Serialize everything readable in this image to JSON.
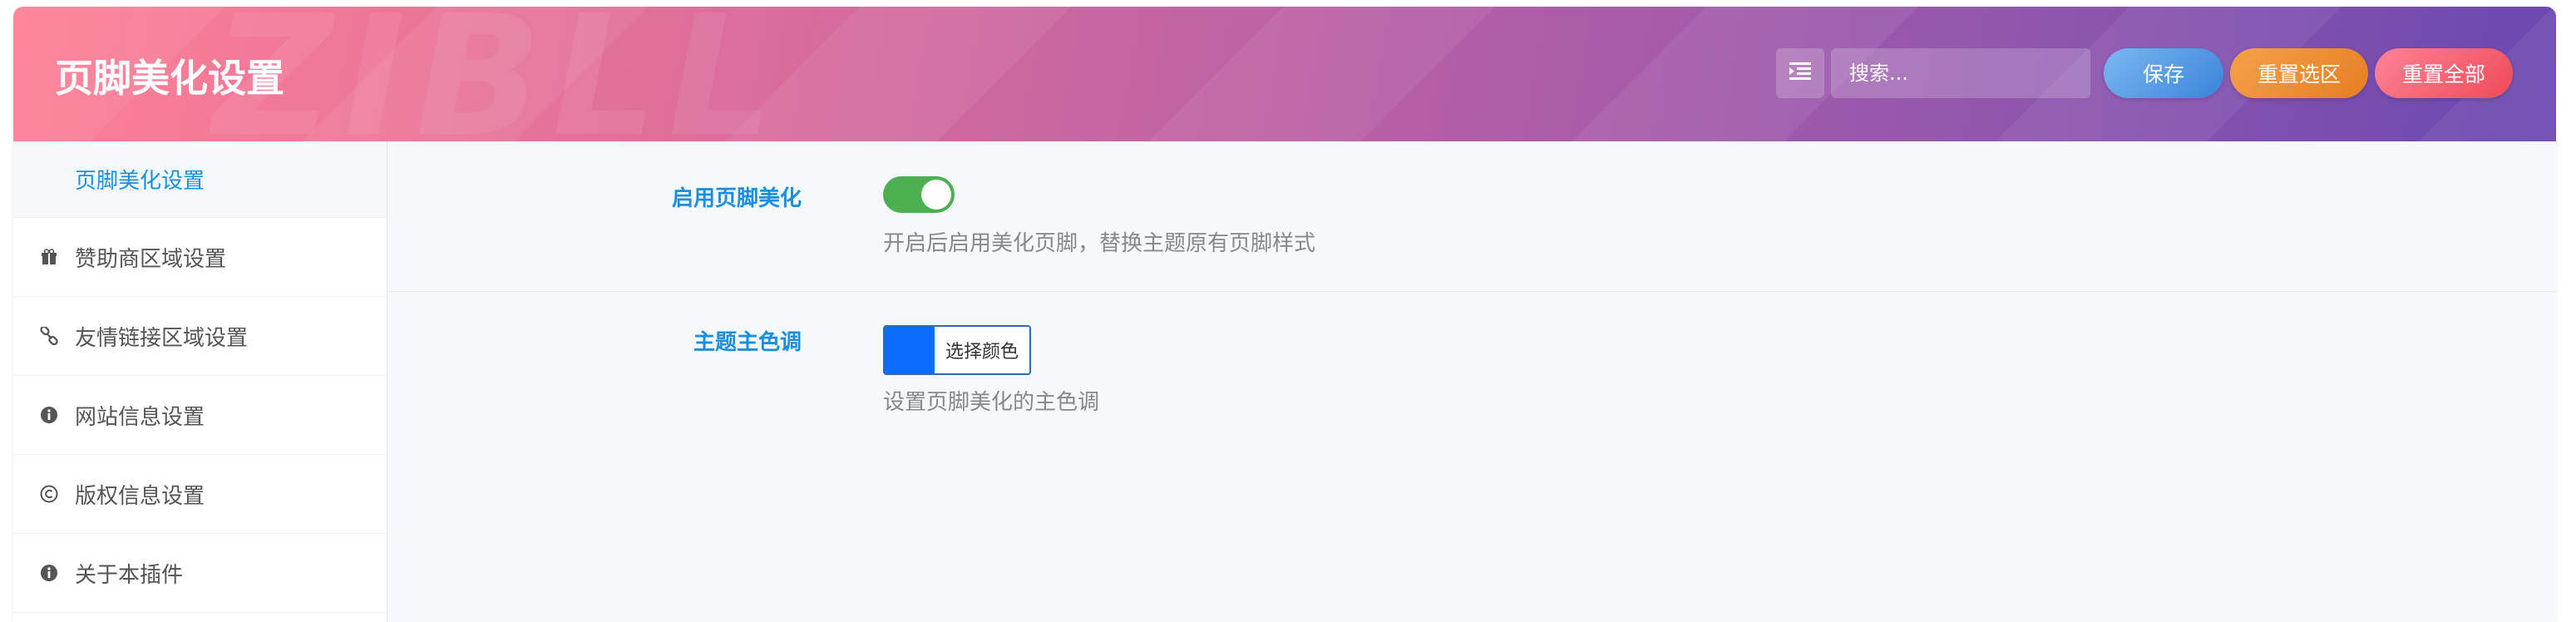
{
  "header": {
    "title": "页脚美化设置",
    "watermark": "ZIBLL",
    "search_placeholder": "搜索...",
    "save_label": "保存",
    "reset_section_label": "重置选区",
    "reset_all_label": "重置全部"
  },
  "sidebar": {
    "items": [
      {
        "label": "页脚美化设置",
        "icon": "none",
        "active": true
      },
      {
        "label": "赞助商区域设置",
        "icon": "gift-icon"
      },
      {
        "label": "友情链接区域设置",
        "icon": "link-icon"
      },
      {
        "label": "网站信息设置",
        "icon": "info-icon"
      },
      {
        "label": "版权信息设置",
        "icon": "copyright-icon"
      },
      {
        "label": "关于本插件",
        "icon": "info-icon"
      }
    ]
  },
  "fields": {
    "enable": {
      "label": "启用页脚美化",
      "enabled": true,
      "description": "开启后启用美化页脚，替换主题原有页脚样式"
    },
    "theme_color": {
      "label": "主题主色调",
      "color": "#0d6efd",
      "button_label": "选择颜色",
      "description": "设置页脚美化的主色调"
    }
  },
  "colors": {
    "accent": "#1a8fe0",
    "toggle_on": "#4cb050"
  }
}
